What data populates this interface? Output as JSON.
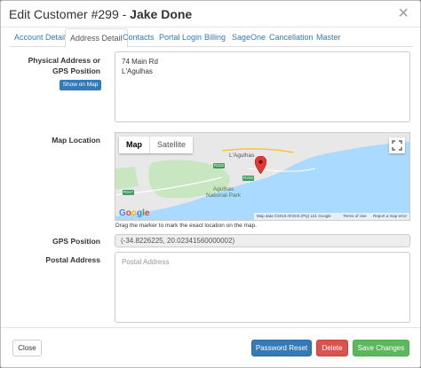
{
  "header": {
    "title_prefix": "Edit Customer #299 - ",
    "customer_name": "Jake Done",
    "close_glyph": "×"
  },
  "tabs": [
    {
      "label": "Account Detail"
    },
    {
      "label": "Address Detail",
      "active": true
    },
    {
      "label": "Contacts"
    },
    {
      "label": "Portal Login"
    },
    {
      "label": "Billing"
    },
    {
      "label": "SageOne"
    },
    {
      "label": "Cancellation"
    },
    {
      "label": "Master"
    }
  ],
  "address": {
    "label_line1": "Physical Address or",
    "label_line2": "GPS Position",
    "show_on_map": "Show on Map",
    "line1": "74 Main Rd",
    "line2": "L'Agulhas"
  },
  "map": {
    "label": "Map Location",
    "type_map": "Map",
    "type_satellite": "Satellite",
    "places": {
      "town": "L'Agulhas",
      "park_line1": "Agulhas",
      "park_line2": "National Park"
    },
    "roads": {
      "r319_a": "R319",
      "r319_b": "R319",
      "r317": "R317"
    },
    "google": "Google",
    "attribution": "Map data ©2018 AfriGIS (Pty) Ltd, Google",
    "terms": "Terms of Use",
    "report": "Report a map error",
    "hint": "Drag the marker to mark the exact location on the map.",
    "colors": {
      "water": "#aadaff",
      "land": "#e8e8e8",
      "park": "#c8e6c0",
      "marker": "#e53935"
    }
  },
  "gps": {
    "label": "GPS Position",
    "value": "(-34.8226225, 20.02341560000002)"
  },
  "postal": {
    "label": "Postal Address",
    "placeholder": "Postal Address"
  },
  "footer": {
    "close": "Close",
    "password_reset": "Password Reset",
    "delete": "Delete",
    "save": "Save Changes"
  }
}
